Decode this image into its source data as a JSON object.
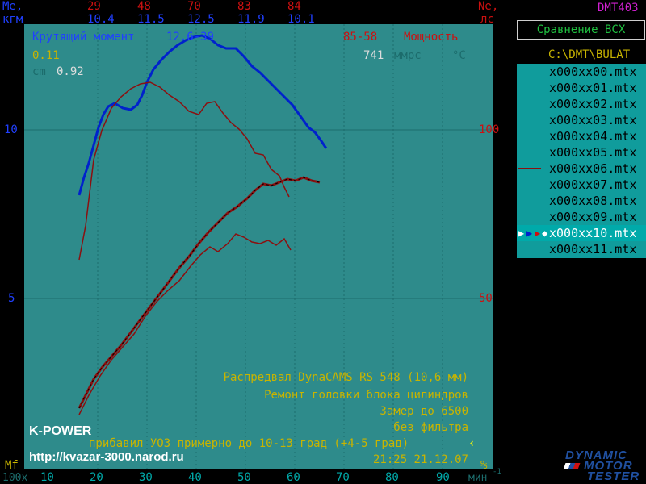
{
  "colors": {
    "plot_bg": "#2e8b8b",
    "grid": "#1c6c6c",
    "torque": "#0022cc",
    "power": "#8b1010",
    "text_blue": "#2040ff",
    "text_red": "#cc1010",
    "text_yellow": "#c8b400",
    "magenta": "#d020d0",
    "list_bg": "#109c9c",
    "list_sel": "#00b4b4",
    "brand_blue": "#2050a0"
  },
  "top_left": {
    "unit1": "Me,",
    "unit2": "кгм"
  },
  "top_right": {
    "unit1": "Ne,",
    "unit2": "лс",
    "device": "DMT403"
  },
  "header_columns": [
    {
      "top": "29",
      "bottom": "10.4"
    },
    {
      "top": "48",
      "bottom": "11.5"
    },
    {
      "top": "70",
      "bottom": "12.5"
    },
    {
      "top": "83",
      "bottom": "11.9"
    },
    {
      "top": "84",
      "bottom": "10.1"
    }
  ],
  "legend": {
    "torque_label": "Крутящий момент",
    "torque_value": "12.6-39",
    "power_value": "85-58",
    "power_label": "Мощность",
    "val_a": "0.11",
    "cm_label": "cm",
    "cm_value": "0.92",
    "pressure": "741",
    "pressure_unit": "ммрс",
    "temp_unit": "°C"
  },
  "compare_button": "Сравнение  ВСХ",
  "dir_path": "C:\\DMT\\BULAT",
  "files": [
    {
      "name": "x000xx00.mtx"
    },
    {
      "name": "x000xx01.mtx"
    },
    {
      "name": "x000xx02.mtx"
    },
    {
      "name": "x000xx03.mtx"
    },
    {
      "name": "x000xx04.mtx"
    },
    {
      "name": "x000xx05.mtx"
    },
    {
      "name": "x000xx06.mtx"
    },
    {
      "name": "x000xx07.mtx"
    },
    {
      "name": "x000xx08.mtx"
    },
    {
      "name": "x000xx09.mtx"
    },
    {
      "name": "x000xx10.mtx"
    },
    {
      "name": "x000xx11.mtx"
    }
  ],
  "notes": [
    "Распредвал DynaCAMS RS 548 (10,6 мм)",
    "Ремонт головки блока цилиндров",
    "Замер до 6500",
    "без фильтра",
    "прибавил УОЗ примерно до 10-13 град (+4-5 град)"
  ],
  "brand": "K-POWER",
  "url": "http://kvazar-3000.narod.ru",
  "datetime": "21:25 21.12.07",
  "y_left_ticks": [
    "10",
    "5"
  ],
  "y_right_ticks": [
    "100",
    "50"
  ],
  "bottom_axis": {
    "left_label": "Mf",
    "mult": "100x",
    "ticks": [
      "10",
      "20",
      "30",
      "40",
      "50",
      "60",
      "70",
      "80",
      "90"
    ],
    "unit": "мин",
    "unit_exp": "-1",
    "percent": "%"
  },
  "logo": {
    "line1": "DYNAMIC",
    "line2": "MOTOR",
    "line3": "TESTER"
  }
}
